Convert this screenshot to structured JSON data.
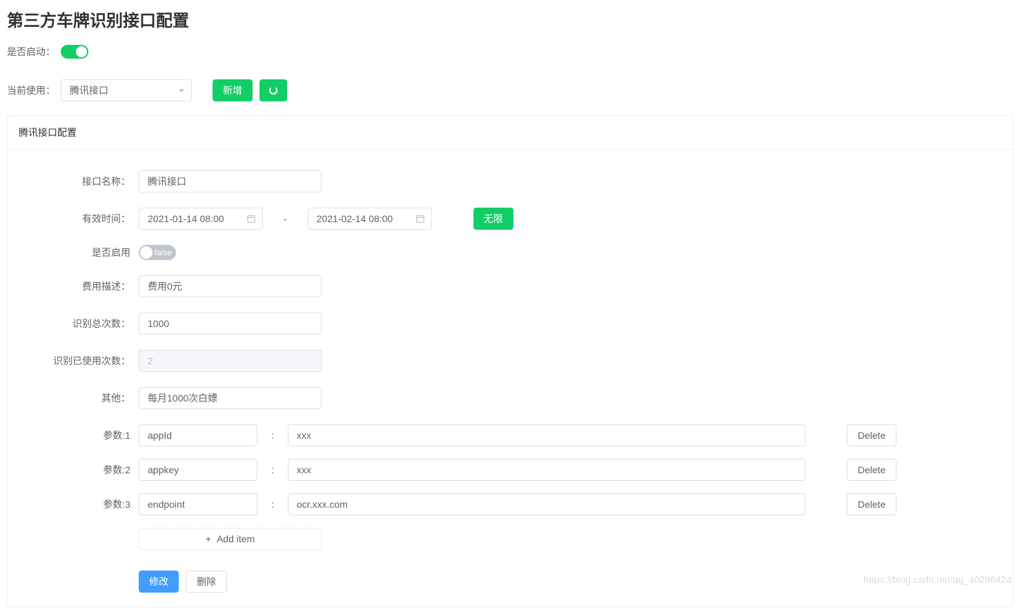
{
  "page_title": "第三方车牌识别接口配置",
  "enable_label": "是否启动：",
  "current_use_label": "当前使用：",
  "current_use_value": "腾讯接口",
  "add_button": "新增",
  "card_title": "腾讯接口配置",
  "form": {
    "name_label": "接口名称：",
    "name_value": "腾讯接口",
    "valid_time_label": "有效时间：",
    "valid_start": "2021-01-14 08:00",
    "valid_end": "2021-02-14 08:00",
    "infinite_label": "无限",
    "enable_label": "是否启用",
    "enable_value": "false",
    "cost_label": "费用描述：",
    "cost_value": "费用0元",
    "total_label": "识别总次数：",
    "total_value": "1000",
    "used_label": "识别已使用次数：",
    "used_value": "2",
    "other_label": "其他：",
    "other_value": "每月1000次白嫖",
    "date_sep": "-"
  },
  "params": [
    {
      "label": "参数:1",
      "key": "appId",
      "value": "xxx",
      "delete": "Delete"
    },
    {
      "label": "参数:2",
      "key": "appkey",
      "value": "xxx",
      "delete": "Delete"
    },
    {
      "label": "参数:3",
      "key": "endpoint",
      "value": "ocr.xxx.com",
      "delete": "Delete"
    }
  ],
  "param_sep": ":",
  "add_item_label": "Add item",
  "add_item_plus": "+",
  "modify_button": "修改",
  "delete_button": "删除",
  "watermark": "https://blog.csdn.net/qq_40286424"
}
